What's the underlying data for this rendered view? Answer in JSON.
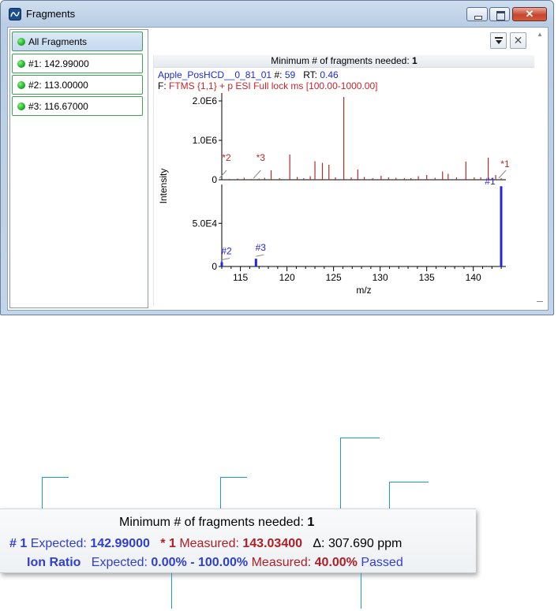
{
  "window": {
    "title": "Fragments"
  },
  "fragment_list": [
    {
      "label": "All Fragments",
      "selected": true
    },
    {
      "label": "#1: 142.99000",
      "selected": false
    },
    {
      "label": "#2: 113.00000",
      "selected": false
    },
    {
      "label": "#3: 116.67000",
      "selected": false
    }
  ],
  "toolbar": {
    "dropdown_icon": "dropdown-filter-icon",
    "close_icon": "close-icon",
    "close_glyph": "✕"
  },
  "header": {
    "min_fragments_label": "Minimum # of fragments needed:",
    "min_fragments_value": "1"
  },
  "scan_info": {
    "file_name": "Apple_PosHCD__0_81_01",
    "scan_label": "#:",
    "scan_value": "59",
    "rt_label": "RT:",
    "rt_value": "0.46",
    "filter_prefix": "F:",
    "filter": "FTMS {1,1}  + p ESI Full lock ms [100.00-1000.00]"
  },
  "chart_data": [
    {
      "type": "bar",
      "ylabel": "Intensity",
      "ylim": [
        0,
        2200000
      ],
      "yticks": [
        "0",
        "1.0E6",
        "2.0E6"
      ],
      "color": "#b22a2a",
      "x": [
        113.8,
        114.7,
        115.4,
        116.2,
        117.0,
        117.6,
        118.3,
        119.2,
        120.3,
        121.1,
        121.8,
        122.5,
        123.0,
        123.8,
        124.5,
        125.2,
        126.1,
        126.9,
        127.6,
        128.3,
        129.2,
        130.1,
        130.9,
        131.7,
        132.6,
        133.3,
        134.1,
        135.0,
        135.9,
        136.7,
        137.3,
        138.2,
        139.2,
        140.1,
        140.8,
        141.6,
        142.4,
        143.0
      ],
      "values": [
        20000,
        30000,
        50000,
        20000,
        30000,
        50000,
        240000,
        40000,
        640000,
        70000,
        40000,
        90000,
        470000,
        430000,
        380000,
        60000,
        2100000,
        60000,
        260000,
        70000,
        40000,
        100000,
        60000,
        50000,
        40000,
        40000,
        90000,
        120000,
        50000,
        210000,
        150000,
        60000,
        460000,
        60000,
        60000,
        560000,
        120000,
        40000
      ],
      "annotations": [
        {
          "label": "*2",
          "x": 113.0
        },
        {
          "label": "*3",
          "x": 116.67
        },
        {
          "label": "*1",
          "x": 142.99
        }
      ]
    },
    {
      "type": "bar",
      "xlabel": "m/z",
      "ylim": [
        0,
        95000
      ],
      "yticks": [
        "0",
        "5.0E4"
      ],
      "xlim": [
        113,
        143.5
      ],
      "xticks": [
        "115",
        "120",
        "125",
        "130",
        "135",
        "140"
      ],
      "color": "#2424e6",
      "series": [
        {
          "name": "#2",
          "x": 113.0,
          "value": 5000
        },
        {
          "name": "#3",
          "x": 116.67,
          "value": 9000
        },
        {
          "name": "#1",
          "x": 142.99,
          "value": 93000
        }
      ]
    }
  ],
  "callout": {
    "min_fragments_label": "Minimum # of fragments needed:",
    "min_fragments_value": "1",
    "frag_id": "# 1",
    "expected_label": "Expected:",
    "expected_value": "142.99000",
    "measured_id": "* 1",
    "measured_label": "Measured:",
    "measured_value": "143.03400",
    "delta_label": "Δ: 307.690 ppm",
    "ion_ratio_label": "Ion Ratio",
    "ion_expected_label": "Expected:",
    "ion_expected_value": "0.00% - 100.00%",
    "ion_measured_label": "Measured:",
    "ion_measured_value": "40.00%",
    "ion_status": "Passed"
  },
  "colors": {
    "blue": "#1d2bd9",
    "red": "#c8232b",
    "leader": "#1a9ad6",
    "bar_red": "#b22a2a",
    "bar_blue": "#2424e6"
  }
}
